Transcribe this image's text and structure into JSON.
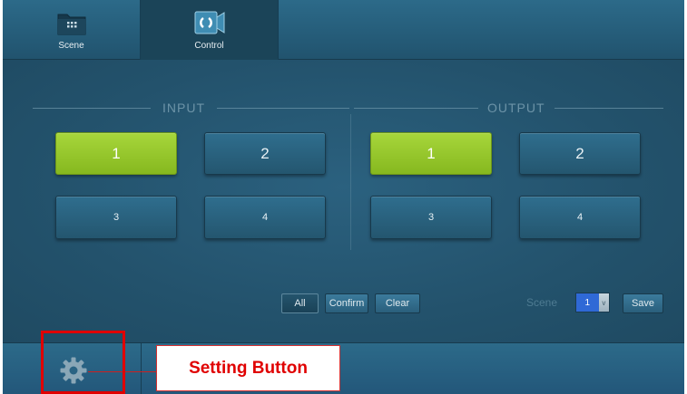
{
  "tabs": [
    {
      "label": "Scene",
      "icon": "folder-grid-icon"
    },
    {
      "label": "Control",
      "icon": "control-switch-icon"
    }
  ],
  "input": {
    "title": "INPUT",
    "ports": [
      {
        "label": "1",
        "active": true
      },
      {
        "label": "2",
        "active": false
      },
      {
        "label": "3",
        "active": false
      },
      {
        "label": "4",
        "active": false
      }
    ]
  },
  "output": {
    "title": "OUTPUT",
    "ports": [
      {
        "label": "1",
        "active": true
      },
      {
        "label": "2",
        "active": false
      },
      {
        "label": "3",
        "active": false
      },
      {
        "label": "4",
        "active": false
      }
    ]
  },
  "actions": {
    "all_label": "All",
    "confirm_label": "Confirm",
    "clear_label": "Clear"
  },
  "scene": {
    "label": "Scene",
    "selected": "1",
    "arrow": "v",
    "save_label": "Save"
  },
  "bottom": {
    "settings_icon": "gear-icon"
  },
  "annotation": {
    "callout_text": "Setting Button"
  },
  "colors": {
    "active_green": "#9acb30",
    "panel_blue": "#24566f",
    "annotation_red": "#e00000"
  }
}
